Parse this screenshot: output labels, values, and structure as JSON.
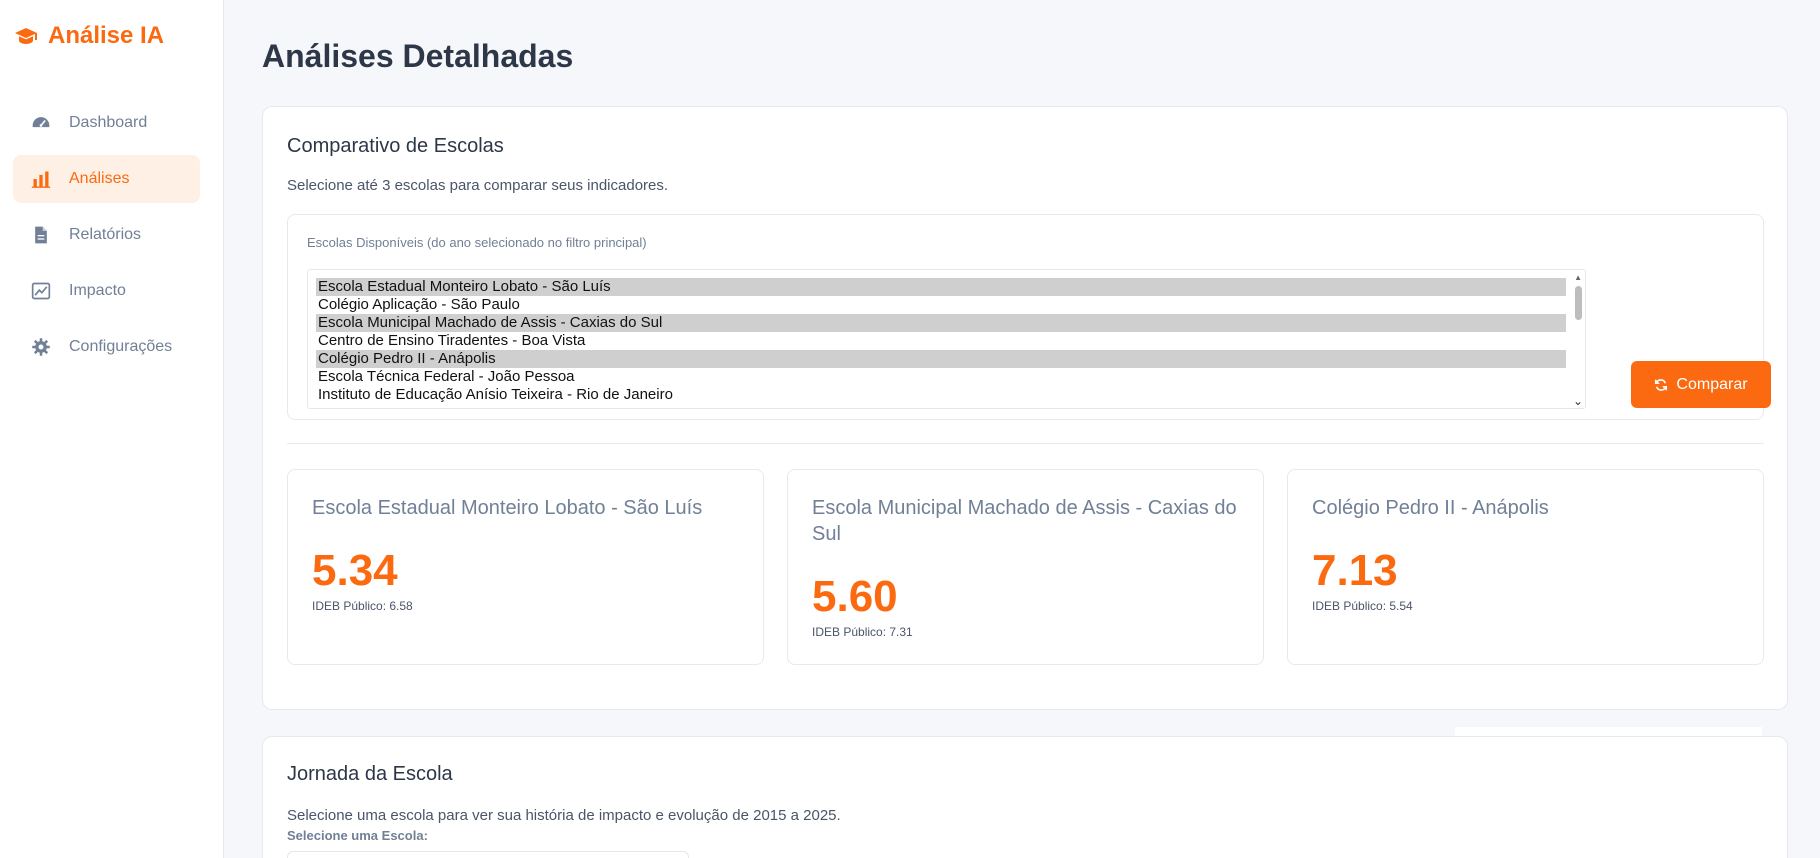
{
  "brand": {
    "name": "Análise IA",
    "icon": "graduation-cap-icon",
    "color": "#fb6a10"
  },
  "sidebar": {
    "items": [
      {
        "label": "Dashboard",
        "icon": "gauge-icon",
        "active": false
      },
      {
        "label": "Análises",
        "icon": "bar-chart-icon",
        "active": true
      },
      {
        "label": "Relatórios",
        "icon": "file-icon",
        "active": false
      },
      {
        "label": "Impacto",
        "icon": "line-chart-icon",
        "active": false
      },
      {
        "label": "Configurações",
        "icon": "gear-icon",
        "active": false
      }
    ]
  },
  "page": {
    "title": "Análises Detalhadas"
  },
  "compare": {
    "title": "Comparativo de Escolas",
    "description": "Selecione até 3 escolas para comparar seus indicadores.",
    "list_label": "Escolas Disponíveis (do ano selecionado no filtro principal)",
    "options": [
      {
        "label": "Escola Estadual Monteiro Lobato - São Luís",
        "selected": true
      },
      {
        "label": "Colégio Aplicação - São Paulo",
        "selected": false
      },
      {
        "label": "Escola Municipal Machado de Assis - Caxias do Sul",
        "selected": true
      },
      {
        "label": "Centro de Ensino Tiradentes - Boa Vista",
        "selected": false
      },
      {
        "label": "Colégio Pedro II - Anápolis",
        "selected": true
      },
      {
        "label": "Escola Técnica Federal - João Pessoa",
        "selected": false
      },
      {
        "label": "Instituto de Educação Anísio Teixeira - Rio de Janeiro",
        "selected": false
      }
    ],
    "button_label": "Comparar",
    "button_icon": "refresh-icon",
    "results": [
      {
        "name": "Escola Estadual Monteiro Lobato - São Luís",
        "score": "5.34",
        "public": "IDEB Público: 6.58"
      },
      {
        "name": "Escola Municipal Machado de Assis - Caxias do Sul",
        "score": "5.60",
        "public": "IDEB Público: 7.31"
      },
      {
        "name": "Colégio Pedro II - Anápolis",
        "score": "7.13",
        "public": "IDEB Público: 5.54"
      }
    ]
  },
  "journey": {
    "title": "Jornada da Escola",
    "description": "Selecione uma escola para ver sua história de impacto e evolução de 2015 a 2025.",
    "select_label": "Selecione uma Escola:"
  }
}
